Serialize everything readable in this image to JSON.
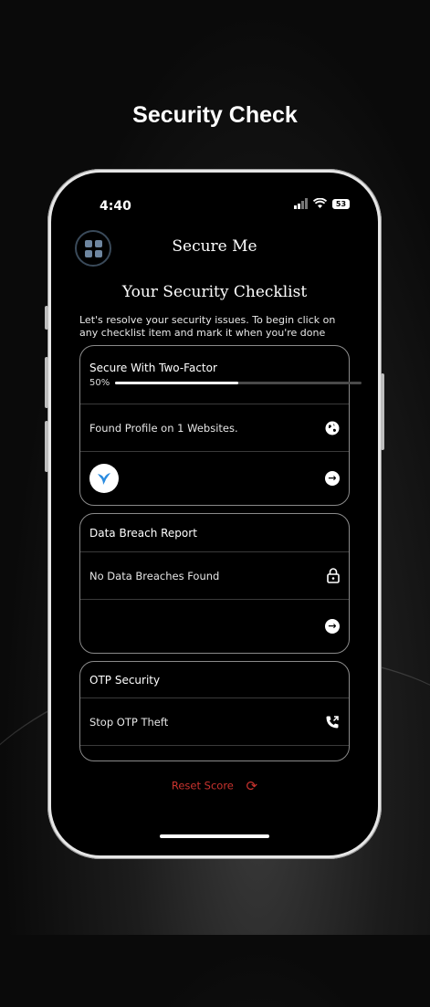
{
  "page": {
    "headline": "Security Check"
  },
  "status_bar": {
    "time": "4:40",
    "battery": "53"
  },
  "app": {
    "title": "Secure Me"
  },
  "checklist": {
    "title": "Your Security Checklist",
    "intro": "Let's resolve your security issues. To begin click on any checklist item and mark it when you're done"
  },
  "cards": {
    "two_factor": {
      "title": "Secure With Two-Factor",
      "progress_label": "50%",
      "progress": 0.5,
      "profile_text": "Found Profile on 1 Websites."
    },
    "breach": {
      "title": "Data Breach Report",
      "status_text": "No Data Breaches Found"
    },
    "otp": {
      "title": "OTP Security",
      "row_text": "Stop OTP Theft"
    }
  },
  "footer": {
    "reset_label": "Reset Score"
  },
  "colors": {
    "accent_red": "#c9332e",
    "grid_icon": "#6e86a0"
  }
}
